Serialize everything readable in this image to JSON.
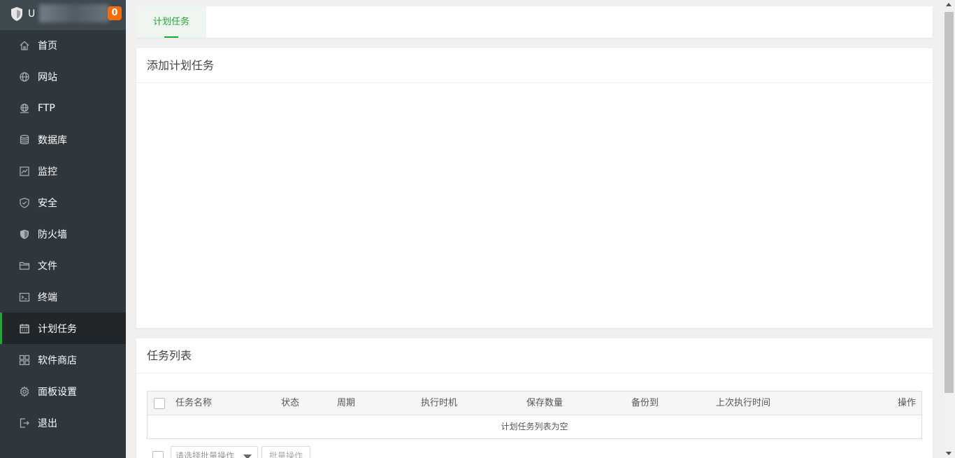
{
  "sidebar": {
    "host_name": "U",
    "notification_count": "0",
    "items": [
      {
        "label": "首页",
        "icon": "home-icon"
      },
      {
        "label": "网站",
        "icon": "globe-icon"
      },
      {
        "label": "FTP",
        "icon": "ftp-icon"
      },
      {
        "label": "数据库",
        "icon": "database-icon"
      },
      {
        "label": "监控",
        "icon": "monitor-icon"
      },
      {
        "label": "安全",
        "icon": "shield-check-icon"
      },
      {
        "label": "防火墙",
        "icon": "firewall-shield-icon"
      },
      {
        "label": "文件",
        "icon": "folder-icon"
      },
      {
        "label": "终端",
        "icon": "terminal-icon"
      },
      {
        "label": "计划任务",
        "icon": "calendar-icon",
        "active": true
      },
      {
        "label": "软件商店",
        "icon": "apps-grid-icon"
      },
      {
        "label": "面板设置",
        "icon": "gear-icon"
      },
      {
        "label": "退出",
        "icon": "logout-icon"
      }
    ]
  },
  "tabs": [
    {
      "label": "计划任务",
      "active": true
    }
  ],
  "add_section": {
    "title": "添加计划任务"
  },
  "list_section": {
    "title": "任务列表",
    "columns": [
      "任务名称",
      "状态",
      "周期",
      "执行时机",
      "保存数量",
      "备份到",
      "上次执行时间",
      "操作"
    ],
    "empty_text": "计划任务列表为空",
    "batch_select_placeholder": "请选择批量操作",
    "batch_button": "批量操作"
  },
  "colors": {
    "accent": "#20a53a",
    "sidebar_bg": "#2f373d",
    "badge": "#f56c0b"
  }
}
